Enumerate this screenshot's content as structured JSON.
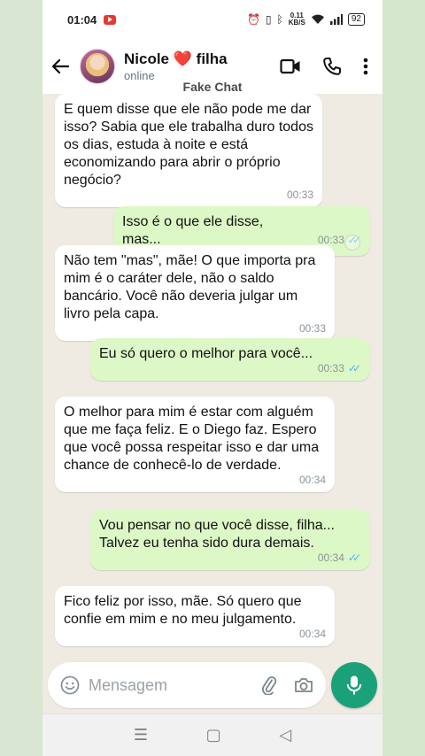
{
  "status_bar": {
    "time": "01:04",
    "net_speed_value": "0.11",
    "net_speed_unit": "KB/S",
    "battery": "92"
  },
  "header": {
    "contact_name": "Nicole",
    "contact_name_suffix": "filha",
    "heart": "❤️",
    "status": "online",
    "watermark": "Fake Chat"
  },
  "messages": [
    {
      "direction": "in",
      "text": "E quem disse que ele não pode me dar isso? Sabia que ele trabalha duro todos os dias, estuda à noite e está economizando para abrir o próprio negócio?",
      "time": "00:33"
    },
    {
      "direction": "out",
      "text": "Isso é o que ele disse, mas...",
      "time": "00:33",
      "read": true
    },
    {
      "direction": "in",
      "text": "Não tem \"mas\", mãe! O que importa pra mim é o caráter dele, não o saldo bancário. Você não deveria julgar um livro pela capa.",
      "time": "00:33"
    },
    {
      "direction": "out",
      "text": "Eu só quero o melhor para você...",
      "time": "00:33",
      "read": true
    },
    {
      "direction": "in",
      "text": "O melhor para mim é estar com alguém que me faça feliz. E o Diego faz. Espero que você possa respeitar isso e dar uma chance de conhecê-lo de verdade.",
      "time": "00:34"
    },
    {
      "direction": "out",
      "text": "Vou pensar no que você disse, filha... Talvez eu tenha sido dura demais.",
      "time": "00:34",
      "read": true
    },
    {
      "direction": "in",
      "text": "Fico feliz por isso, mãe. Só quero que confie em mim e no meu julgamento.",
      "time": "00:34"
    }
  ],
  "composer": {
    "placeholder": "Mensagem"
  },
  "colors": {
    "outgoing_bubble": "#dcf8c6",
    "incoming_bubble": "#ffffff",
    "chat_background": "#efeae2",
    "accent": "#1aa179",
    "read_ticks": "#4fb6ec"
  },
  "icons": [
    "back-arrow-icon",
    "video-call-icon",
    "phone-icon",
    "more-vert-icon",
    "emoji-icon",
    "attach-icon",
    "camera-icon",
    "mic-icon",
    "nav-recents-icon",
    "nav-home-icon",
    "nav-back-icon"
  ]
}
